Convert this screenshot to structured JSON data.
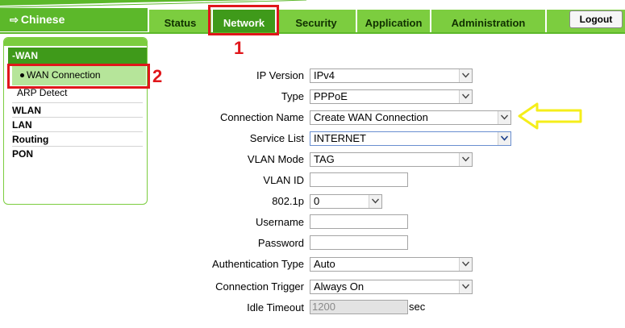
{
  "header": {
    "language_label": "Chinese",
    "tabs": [
      {
        "label": "Status"
      },
      {
        "label": "Network"
      },
      {
        "label": "Security"
      },
      {
        "label": "Application"
      },
      {
        "label": "Administration"
      }
    ],
    "logout_label": "Logout"
  },
  "annotations": {
    "marker_1": "1",
    "marker_2": "2"
  },
  "sidebar": {
    "section": "-WAN",
    "selected_item": "WAN Connection",
    "sub_item": "ARP Detect",
    "items": [
      "WLAN",
      "LAN",
      "Routing",
      "PON"
    ]
  },
  "form": {
    "ip_version": {
      "label": "IP Version",
      "value": "IPv4"
    },
    "type": {
      "label": "Type",
      "value": "PPPoE"
    },
    "connection_name": {
      "label": "Connection Name",
      "value": "Create WAN Connection"
    },
    "service_list": {
      "label": "Service List",
      "value": "INTERNET"
    },
    "vlan_mode": {
      "label": "VLAN Mode",
      "value": "TAG"
    },
    "vlan_id": {
      "label": "VLAN ID",
      "value": ""
    },
    "priority": {
      "label": "802.1p",
      "value": "0"
    },
    "username": {
      "label": "Username",
      "value": ""
    },
    "password": {
      "label": "Password",
      "value": ""
    },
    "auth_type": {
      "label": "Authentication Type",
      "value": "Auto"
    },
    "conn_trigger": {
      "label": "Connection Trigger",
      "value": "Always On"
    },
    "idle_timeout": {
      "label": "Idle Timeout",
      "value": "1200",
      "unit": "sec"
    }
  },
  "colors": {
    "accent_green": "#5cb82a",
    "active_tab": "#3f9a1a",
    "annotation_red": "#e0161b",
    "annotation_yellow": "#f5ee1a"
  }
}
